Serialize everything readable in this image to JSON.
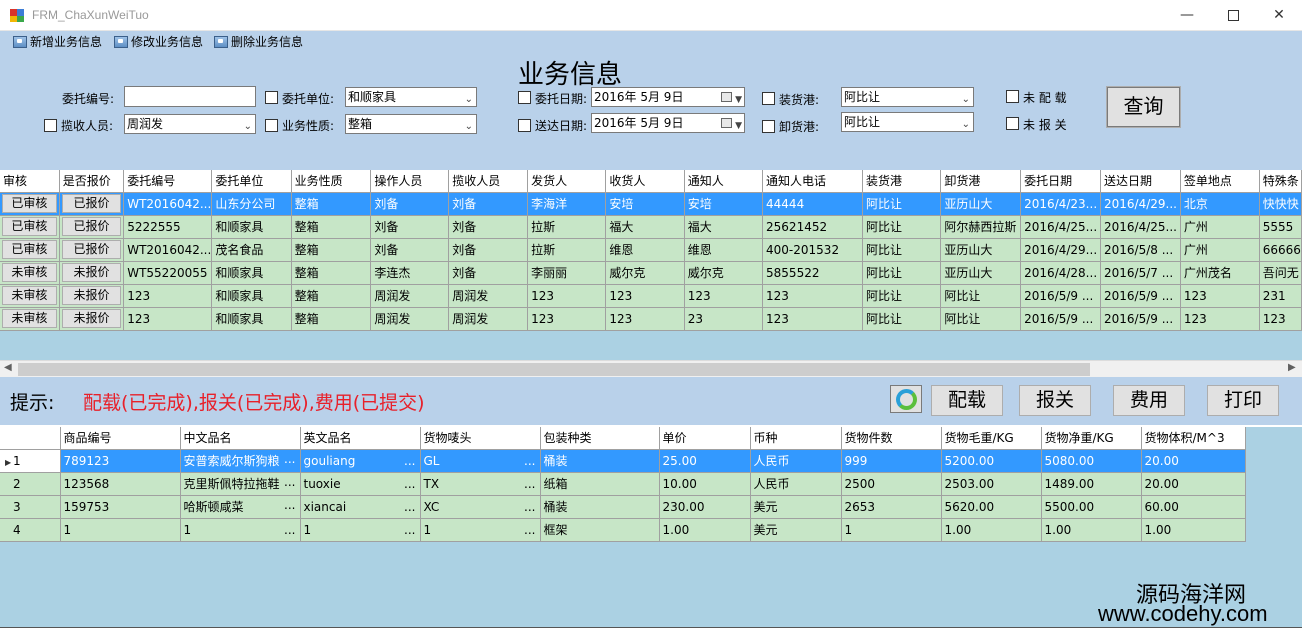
{
  "window": {
    "title": "FRM_ChaXunWeiTuo",
    "minimize_glyph": "—",
    "close_glyph": "✕"
  },
  "toolbar": {
    "items": [
      {
        "label": "新增业务信息",
        "icon": "add-document-icon"
      },
      {
        "label": "修改业务信息",
        "icon": "edit-document-icon"
      },
      {
        "label": "删除业务信息",
        "icon": "delete-document-icon"
      }
    ]
  },
  "search": {
    "title": "业务信息",
    "entrust_no_label": "委托编号:",
    "entrust_no_value": "",
    "entrust_unit_label": "委托单位:",
    "entrust_unit_value": "和顺家具",
    "entrust_date_label": "委托日期:",
    "entrust_date_value": "2016年 5月 9日",
    "load_port_label": "装货港:",
    "load_port_value": "阿比让",
    "unassigned_label": "未 配 载",
    "collector_label": "揽收人员:",
    "collector_value": "周润发",
    "business_type_label": "业务性质:",
    "business_type_value": "整箱",
    "delivery_date_label": "送达日期:",
    "delivery_date_value": "2016年 5月 9日",
    "discharge_port_label": "卸货港:",
    "discharge_port_value": "阿比让",
    "undeclared_label": "未 报 关",
    "query_button": "查询"
  },
  "grid1": {
    "headers": [
      "审核",
      "是否报价",
      "委托编号",
      "委托单位",
      "业务性质",
      "操作人员",
      "揽收人员",
      "发货人",
      "收货人",
      "通知人",
      "通知人电话",
      "装货港",
      "卸货港",
      "委托日期",
      "送达日期",
      "签单地点",
      "特殊条"
    ],
    "rows": [
      [
        "已审核",
        "已报价",
        "WT2016042...",
        "山东分公司",
        "整箱",
        "刘备",
        "刘备",
        "李海洋",
        "安培",
        "安培",
        "44444",
        "阿比让",
        "亚历山大",
        "2016/4/23...",
        "2016/4/29...",
        "北京",
        "快快快"
      ],
      [
        "已审核",
        "已报价",
        "5222555",
        "和顺家具",
        "整箱",
        "刘备",
        "刘备",
        "拉斯",
        "福大",
        "福大",
        "25621452",
        "阿比让",
        "阿尔赫西拉斯",
        "2016/4/25...",
        "2016/4/25...",
        "广州",
        "5555"
      ],
      [
        "已审核",
        "已报价",
        "WT2016042...",
        "茂名食品",
        "整箱",
        "刘备",
        "刘备",
        "拉斯",
        "维恩",
        "维恩",
        "400-201532",
        "阿比让",
        "亚历山大",
        "2016/4/29...",
        "2016/5/8 ...",
        "广州",
        "66666"
      ],
      [
        "未审核",
        "未报价",
        "WT55220055",
        "和顺家具",
        "整箱",
        "李连杰",
        "刘备",
        "李丽丽",
        "威尔克",
        "威尔克",
        "5855522",
        "阿比让",
        "亚历山大",
        "2016/4/28...",
        "2016/5/7 ...",
        "广州茂名",
        "吾问无"
      ],
      [
        "未审核",
        "未报价",
        "123",
        "和顺家具",
        "整箱",
        "周润发",
        "周润发",
        "123",
        "123",
        "123",
        "123",
        "阿比让",
        "阿比让",
        "2016/5/9 ...",
        "2016/5/9 ...",
        "123",
        "231"
      ],
      [
        "未审核",
        "未报价",
        "123",
        "和顺家具",
        "整箱",
        "周润发",
        "周润发",
        "123",
        "123",
        "23",
        "123",
        "阿比让",
        "阿比让",
        "2016/5/9 ...",
        "2016/5/9 ...",
        "123",
        "123"
      ]
    ]
  },
  "scrollbar": {
    "left_glyph": "◀",
    "right_glyph": "▶"
  },
  "hint": {
    "label": "提示:",
    "text": "配载(已完成),报关(已完成),费用(已提交)"
  },
  "actions": {
    "stowage": "配载",
    "customs": "报关",
    "fees": "费用",
    "print": "打印"
  },
  "grid2": {
    "current_row_glyph": "▶",
    "ellipsis": "...",
    "headers": [
      "商品编号",
      "中文品名",
      "英文品名",
      "货物唛头",
      "包装种类",
      "单价",
      "币种",
      "货物件数",
      "货物毛重/KG",
      "货物净重/KG",
      "货物体积/M^3"
    ],
    "rows": [
      {
        "no": "1",
        "cells": [
          "789123",
          "安普索威尔斯狗粮",
          "gouliang",
          "GL",
          "桶装",
          "25.00",
          "人民币",
          "999",
          "5200.00",
          "5080.00",
          "20.00"
        ]
      },
      {
        "no": "2",
        "cells": [
          "123568",
          "克里斯佩特拉拖鞋",
          "tuoxie",
          "TX",
          "纸箱",
          "10.00",
          "人民币",
          "2500",
          "2503.00",
          "1489.00",
          "20.00"
        ]
      },
      {
        "no": "3",
        "cells": [
          "159753",
          "哈斯顿咸菜",
          "xiancai",
          "XC",
          "桶装",
          "230.00",
          "美元",
          "2653",
          "5620.00",
          "5500.00",
          "60.00"
        ]
      },
      {
        "no": "4",
        "cells": [
          "1",
          "1",
          "1",
          "1",
          "框架",
          "1.00",
          "美元",
          "1",
          "1.00",
          "1.00",
          "1.00"
        ]
      }
    ]
  },
  "watermark": {
    "line1": "源码海洋网",
    "line2": "www.codehy.com"
  },
  "colors": {
    "panel": "#b9d1ea",
    "grid_bg": "#abd1e3",
    "row": "#c7e6c7",
    "selected": "#3399ff",
    "hint_red": "#e8202a"
  }
}
